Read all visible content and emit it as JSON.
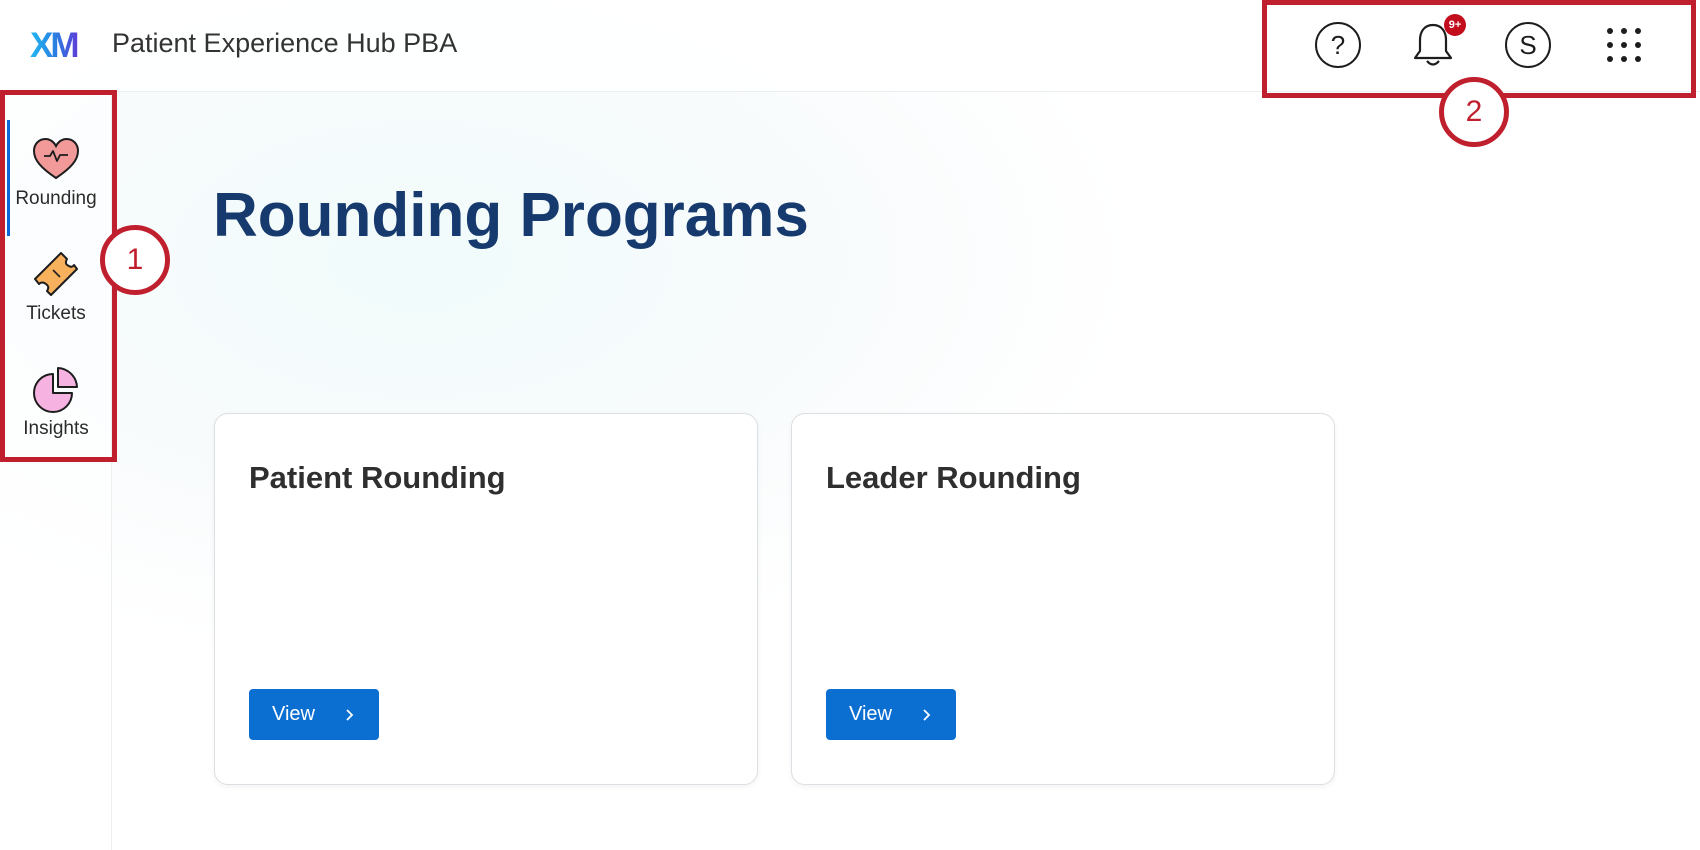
{
  "header": {
    "app_title": "Patient Experience Hub PBA",
    "logo_text": "XM",
    "notifications_badge": "9+",
    "avatar_initial": "S",
    "help_symbol": "?"
  },
  "sidebar": {
    "items": [
      {
        "label": "Rounding",
        "icon": "heart-icon",
        "active": true
      },
      {
        "label": "Tickets",
        "icon": "ticket-icon",
        "active": false
      },
      {
        "label": "Insights",
        "icon": "pie-chart-icon",
        "active": false
      }
    ]
  },
  "annotations": [
    "1",
    "2"
  ],
  "main": {
    "title": "Rounding Programs",
    "cards": [
      {
        "title": "Patient Rounding",
        "button_label": "View"
      },
      {
        "title": "Leader Rounding",
        "button_label": "View"
      }
    ]
  },
  "colors": {
    "accent": "#0b6fd1",
    "title": "#163a6e",
    "annotation": "#c0202e",
    "badge": "#c20d1d"
  }
}
